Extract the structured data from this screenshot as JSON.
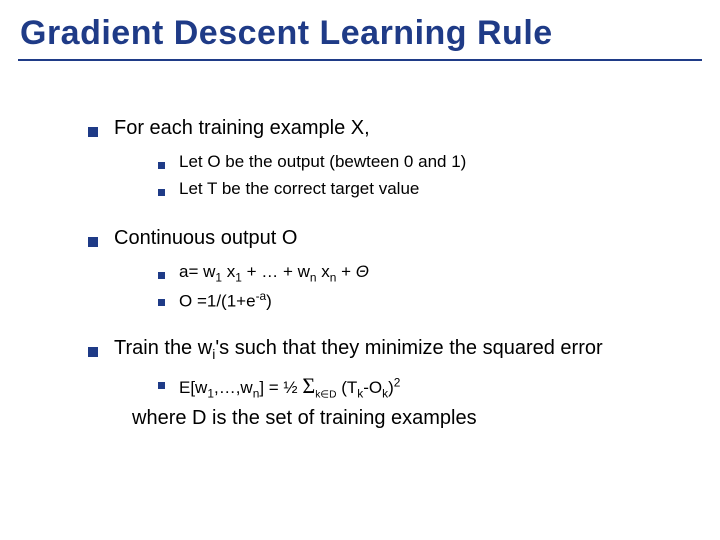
{
  "title": "Gradient Descent Learning Rule",
  "bullets": {
    "b1": {
      "text": "For each training example X,",
      "sub": {
        "s1": "Let O be the output (bewteen 0 and 1)",
        "s2": "Let T be the correct target value"
      }
    },
    "b2": {
      "text": "Continuous output O",
      "sub": {
        "s1_pre": "a= w",
        "s1_x1": " x",
        "s1_mid": " + … + w",
        "s1_xn": " x",
        "s1_post": " + ",
        "s1_theta": "Θ",
        "s2_pre": "O =1/(1+e",
        "s2_exp": "-a",
        "s2_post": ")"
      }
    },
    "b3": {
      "text_pre": "Train the w",
      "text_post": "'s such that they minimize the squared error",
      "sub": {
        "s1_pre": "E[w",
        "s1_mid": ",…,w",
        "s1_brk": "] = ½ ",
        "s1_sigma": "Σ",
        "s1_sumsub": "k∈D",
        "s1_open": " (T",
        "s1_dash": "-O",
        "s1_close": ")",
        "s1_exp": "2"
      },
      "where": "where D is the set of training examples"
    }
  },
  "idx": {
    "one": "1",
    "n": "n",
    "i": "i",
    "k": "k"
  }
}
